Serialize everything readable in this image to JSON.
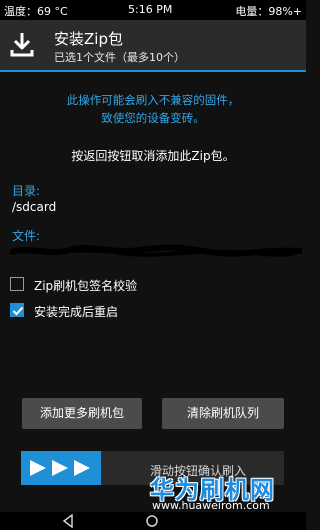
{
  "status_bar": {
    "temperature": "温度：69 °C",
    "time": "5:16 PM",
    "battery": "电量：98%+"
  },
  "header": {
    "icon": "zip-install-icon",
    "title": "安装Zip包",
    "subtitle": "已选1个文件（最多10个）"
  },
  "warning": {
    "line1": "此操作可能会刷入不兼容的固件，",
    "line2": "致使您的设备变砖。"
  },
  "info_text": "按返回按钮取消添加此Zip包。",
  "directory": {
    "label": "目录:",
    "value": "/sdcard"
  },
  "file": {
    "label": "文件:"
  },
  "options": [
    {
      "label": "Zip刷机包签名校验",
      "checked": false
    },
    {
      "label": "安装完成后重启",
      "checked": true
    }
  ],
  "buttons": {
    "add_more": "添加更多刷机包",
    "clear_queue": "清除刷机队列"
  },
  "slider": {
    "label": "滑动按钮确认刷入"
  },
  "watermark": {
    "name": "华为刷机网",
    "url": "www.huaweirom.com"
  },
  "nav_bar": {
    "icons": [
      "back-icon",
      "home-icon"
    ]
  },
  "colors": {
    "accent": "#1f8fd6",
    "warning_text": "#33a6e6",
    "background": "#111111",
    "header_bg": "#2b2b2b",
    "button_bg": "#4b4b4b"
  }
}
